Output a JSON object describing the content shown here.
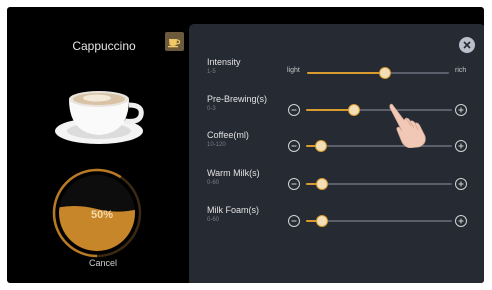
{
  "drink": {
    "name": "Cappuccino",
    "progress_label": "50%",
    "progress": 0.5,
    "cancel_label": "Cancel"
  },
  "colors": {
    "accent": "#d79b2e",
    "panel": "#262a33",
    "background": "#000000"
  },
  "icons": {
    "tab": "coffee-cup-icon",
    "close": "close-icon",
    "minus": "minus-icon",
    "plus": "plus-icon"
  },
  "settings": [
    {
      "label": "Intensity",
      "range": "1-5",
      "min_label": "light",
      "max_label": "rich",
      "level": 0.55
    },
    {
      "label": "Pre-Brewing(s)",
      "range": "0-3",
      "level": 0.33
    },
    {
      "label": "Coffee(ml)",
      "range": "10-120",
      "level": 0.1
    },
    {
      "label": "Warm Milk(s)",
      "range": "0-60",
      "level": 0.11
    },
    {
      "label": "Milk Foam(s)",
      "range": "0-60",
      "level": 0.11
    }
  ]
}
